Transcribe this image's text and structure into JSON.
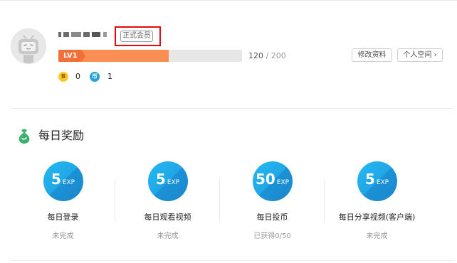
{
  "profile": {
    "member_tag": "正式会员",
    "level_label": "LV1",
    "exp_current": "120",
    "exp_separator": "/",
    "exp_max": "200",
    "exp_progress_fraction": 0.6,
    "edit_button": "修改资料",
    "space_button": "个人空间",
    "space_button_arrow": "›",
    "b_coin_icon_label": "B",
    "b_coin_count": "0",
    "coin_icon_label": "币",
    "coin_count": "1"
  },
  "rewards": {
    "title": "每日奖励",
    "tasks": [
      {
        "value": "5",
        "unit": "EXP",
        "name": "每日登录",
        "status": "未完成"
      },
      {
        "value": "5",
        "unit": "EXP",
        "name": "每日观看视频",
        "status": "未完成"
      },
      {
        "value": "50",
        "unit": "EXP",
        "name": "每日投币",
        "status": "已获得0/50"
      },
      {
        "value": "5",
        "unit": "EXP",
        "name": "每日分享视频(客户端)",
        "status": "未完成"
      }
    ]
  },
  "colors": {
    "accent_blue": "#21a6e6",
    "level_orange": "#fb8e52",
    "highlight_red": "#e20a0a",
    "b_coin_yellow": "#fbc627",
    "coin_blue": "#23a0d8",
    "reward_icon_green": "#3cb26f"
  },
  "icons": {
    "avatar": "bilibili-tv-avatar-icon",
    "reward_section": "money-bag-icon"
  }
}
